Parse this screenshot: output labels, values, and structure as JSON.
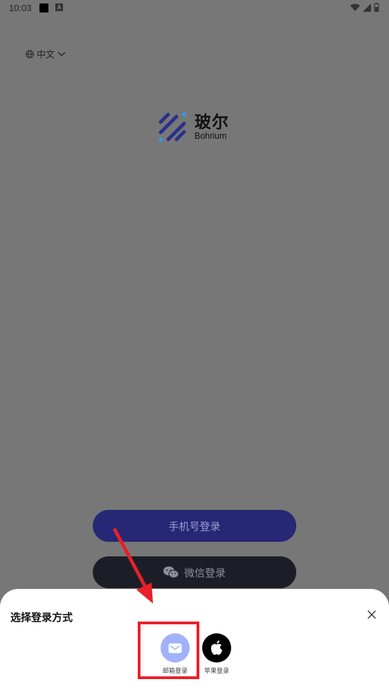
{
  "status_bar": {
    "time": "10:03",
    "a_icon": "A"
  },
  "language": {
    "label": "中文"
  },
  "brand": {
    "name_cn": "玻尔",
    "name_en": "Bohrium",
    "colors": {
      "navy": "#2b2f8a",
      "cyan": "#2f9ee8"
    }
  },
  "buttons": {
    "phone_login": "手机号登录",
    "wechat_login": "微信登录"
  },
  "sheet": {
    "title": "选择登录方式",
    "options": [
      {
        "label": "邮箱登录",
        "icon": "email-icon"
      },
      {
        "label": "苹果登录",
        "icon": "apple-icon"
      }
    ]
  },
  "annotation": {
    "color": "#e8202a"
  }
}
